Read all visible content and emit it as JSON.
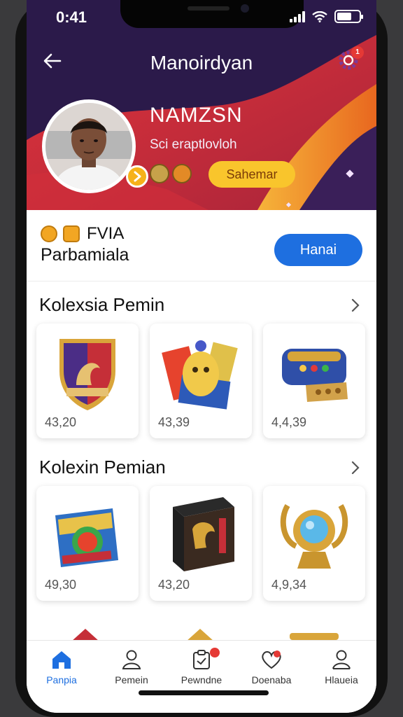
{
  "status_bar": {
    "time": "0:41",
    "icons": [
      "cellular-signal-icon",
      "wifi-icon",
      "battery-icon"
    ]
  },
  "header": {
    "title": "Manoirdyan",
    "back_icon": "arrow-left-icon",
    "settings_icon": "gear-icon",
    "notification_count": "1",
    "player_name": "NAMZSN",
    "player_subtitle": "Sci eraptlovloh",
    "action_button": "Sahemar"
  },
  "profile_row": {
    "currency_label": "FVIA",
    "club_name": "Parbamiala",
    "button_label": "Hanai"
  },
  "sections": [
    {
      "title": "Kolexsia Pemin",
      "items": [
        {
          "icon": "club-crest-icon",
          "value": "43,20"
        },
        {
          "icon": "trophy-pack-icon",
          "value": "43,39"
        },
        {
          "icon": "machine-icon",
          "value": "4,4,39"
        }
      ]
    },
    {
      "title": "Kolexin Pemian",
      "items": [
        {
          "icon": "card-pack-icon",
          "value": "49,30"
        },
        {
          "icon": "mystery-box-icon",
          "value": "43,20"
        },
        {
          "icon": "golden-orb-icon",
          "value": "4,9,34"
        }
      ]
    }
  ],
  "bottom_nav": [
    {
      "label": "Panpia",
      "icon": "home-icon",
      "active": true
    },
    {
      "label": "Pemein",
      "icon": "user-icon",
      "active": false
    },
    {
      "label": "Pewndne",
      "icon": "clipboard-icon",
      "active": false
    },
    {
      "label": "Doenaba",
      "icon": "heart-icon",
      "active": false
    },
    {
      "label": "Hlaueia",
      "icon": "profile-icon",
      "active": false
    }
  ],
  "colors": {
    "accent_blue": "#1e6fe0",
    "header_purple": "#2b1a4a",
    "header_red": "#c62a35",
    "header_orange": "#f08a24",
    "gold": "#f9c52c"
  }
}
